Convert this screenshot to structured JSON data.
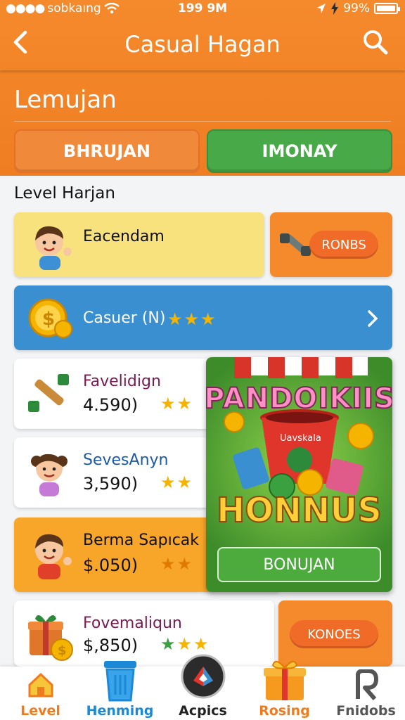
{
  "status": {
    "carrier": "sobkaıng",
    "time": "199 9M",
    "battery": "99%"
  },
  "header": {
    "title": "Casual Hagan"
  },
  "section": {
    "title": "Lemujan"
  },
  "tabs": [
    {
      "label": "BHRUJAN"
    },
    {
      "label": "IMONAY"
    }
  ],
  "subheading": "Level Harjan",
  "items": [
    {
      "name": "Eacendam",
      "action": "RONBS"
    },
    {
      "name": "Casuer (N)",
      "stars": 3
    },
    {
      "name": "Favelidign",
      "value": "4.590)",
      "stars": 3
    },
    {
      "name": "SevesAnyn",
      "value": "3,590)",
      "stars": 2
    },
    {
      "name": "Berma Sapıcak",
      "value": "$.050)",
      "stars": 2
    },
    {
      "name": "Fovemaliqun",
      "value": "$,850)",
      "stars": 3,
      "action": "KONOES"
    }
  ],
  "promo": {
    "brand": "PANDOIKIIS",
    "tag": "Uavskala",
    "headline": "HONNUS",
    "button": "BONUJAN"
  },
  "bottom_nav": [
    {
      "label": "Level",
      "icon": "home-icon",
      "color": "#f07a1e"
    },
    {
      "label": "Henming",
      "icon": "trash-icon",
      "color": "#1b89d6"
    },
    {
      "label": "Acpics",
      "icon": "apps-icon",
      "color": "#222222"
    },
    {
      "label": "Rosing",
      "icon": "gift-icon",
      "color": "#f07a1e"
    },
    {
      "label": "Fnidobs",
      "icon": "profile-icon",
      "color": "#555555"
    }
  ],
  "colors": {
    "orange": "#f58a2c",
    "green": "#48a948",
    "blue": "#3a8fd0",
    "yellow": "#f7e27a",
    "gold": "#f5b400"
  }
}
